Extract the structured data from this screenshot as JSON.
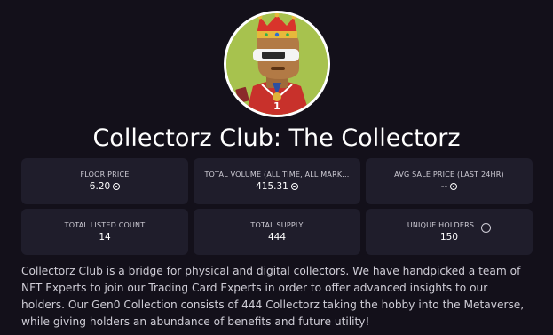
{
  "collection": {
    "title": "Collectorz Club: The Collectorz",
    "description": "Collectorz Club is a bridge for physical and digital collectors. We have handpicked a team of NFT Experts to join our Trading Card Experts in order to offer advanced insights to our holders. Our Gen0 Collection consists of 444 Collectorz taking the hobby into the Metaverse, while giving holders an abundance of benefits and future utility!"
  },
  "stats": {
    "floor_price": {
      "label": "FLOOR PRICE",
      "value": "6.20"
    },
    "total_volume": {
      "label": "TOTAL VOLUME (ALL TIME, ALL MARK...",
      "value": "415.31"
    },
    "avg_sale_price": {
      "label": "AVG SALE PRICE (LAST 24HR)",
      "value": "--"
    },
    "total_listed_count": {
      "label": "TOTAL LISTED COUNT",
      "value": "14"
    },
    "total_supply": {
      "label": "TOTAL SUPPLY",
      "value": "444"
    },
    "unique_holders": {
      "label": "UNIQUE HOLDERS",
      "value": "150",
      "info_icon": "i"
    }
  },
  "colors": {
    "background": "#13101a",
    "card": "#1f1d2b",
    "avatar_bg": "#a7c24e"
  },
  "icons": {
    "currency": "sol-icon",
    "info": "info-icon"
  }
}
